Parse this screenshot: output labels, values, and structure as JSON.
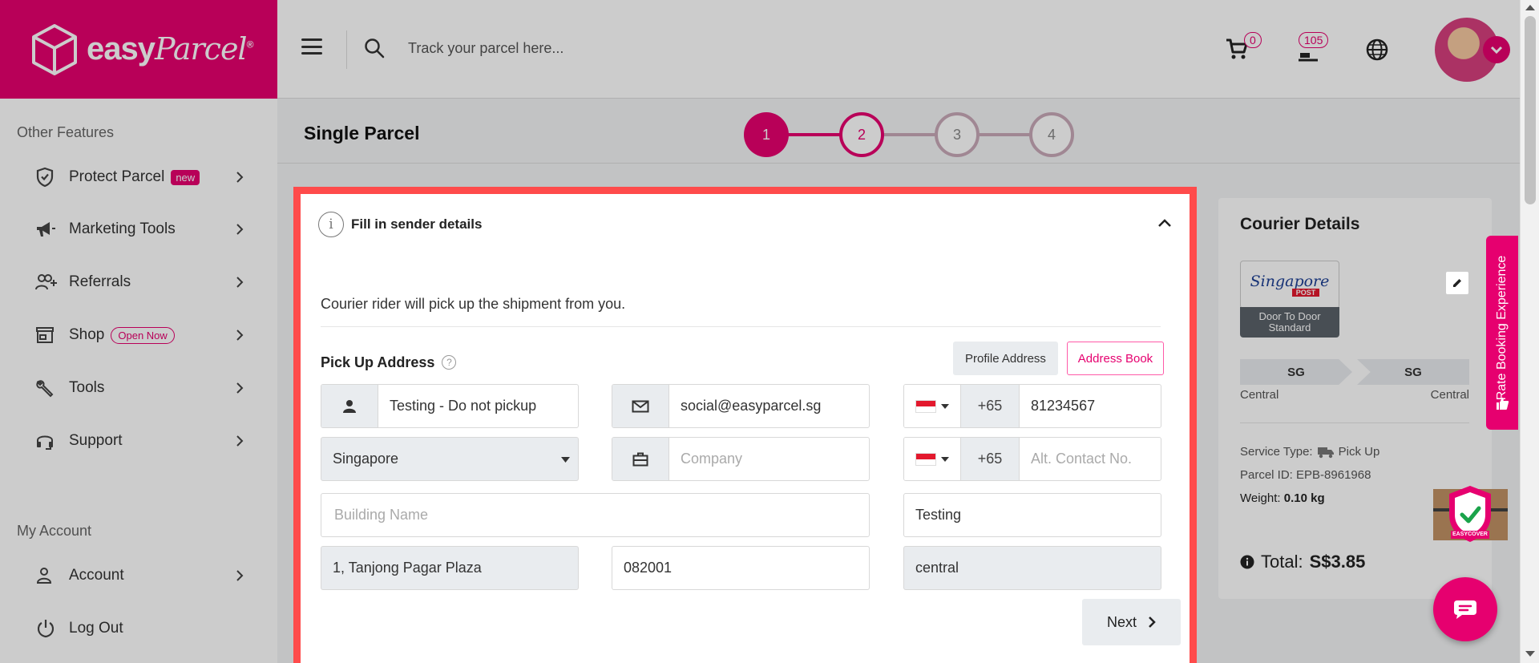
{
  "brand": {
    "name": "easy",
    "name_script": "Parcel",
    "reg": "®"
  },
  "search": {
    "placeholder": "Track your parcel here..."
  },
  "header": {
    "cart_count": "0",
    "notification_count": "105"
  },
  "sidebar": {
    "section_other": "Other Features",
    "items": [
      {
        "label": "Protect Parcel",
        "badge": "new"
      },
      {
        "label": "Marketing Tools"
      },
      {
        "label": "Referrals"
      },
      {
        "label": "Shop",
        "badge": "Open Now"
      },
      {
        "label": "Tools"
      },
      {
        "label": "Support"
      }
    ],
    "section_account": "My Account",
    "account_items": [
      {
        "label": "Account"
      },
      {
        "label": "Log Out"
      }
    ]
  },
  "page": {
    "title": "Single Parcel",
    "steps": [
      "1",
      "2",
      "3",
      "4"
    ],
    "current_step": 1
  },
  "sender": {
    "title": "Fill in sender details",
    "subtext": "Courier rider will pick up the shipment from you.",
    "pickup_label": "Pick Up Address",
    "help": "?",
    "profile_btn": "Profile Address",
    "address_book_btn": "Address Book",
    "name": "Testing - Do not pickup",
    "email": "social@easyparcel.sg",
    "dial_code": "+65",
    "phone": "81234567",
    "country": "Singapore",
    "company_placeholder": "Company",
    "alt_dial_code": "+65",
    "alt_phone_placeholder": "Alt. Contact No.",
    "building_placeholder": "Building Name",
    "unit": "Testing",
    "address": "1, Tanjong Pagar Plaza",
    "postcode": "082001",
    "area": "central",
    "next_btn": "Next"
  },
  "courier": {
    "title": "Courier Details",
    "logo_script": "Singapore",
    "logo_post": "POST",
    "service_name": "Door To Door Standard",
    "from_country": "SG",
    "to_country": "SG",
    "from_area": "Central",
    "to_area": "Central",
    "service_type_label": "Service Type:",
    "service_type": "Pick Up",
    "parcel_id_label": "Parcel ID:",
    "parcel_id": "EPB-8961968",
    "weight_label": "Weight:",
    "weight": "0.10 kg",
    "total_label": "Total:",
    "total": "S$3.85",
    "easycover": "EASYCOVER"
  },
  "rate_tab": {
    "label": "Rate Booking Experience"
  },
  "colors": {
    "brand": "#e6006f",
    "highlight": "#ff4b4b",
    "step_inactive": "#b08fa0"
  }
}
